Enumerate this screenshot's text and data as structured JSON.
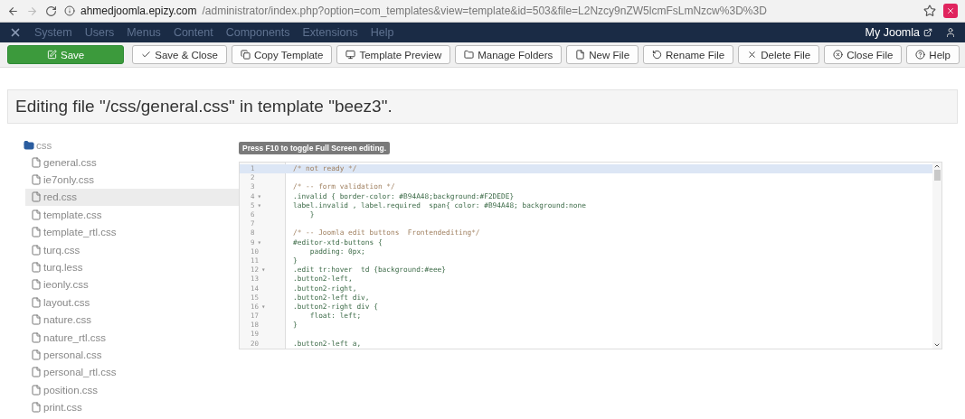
{
  "browser": {
    "url_host": "ahmedjoomla.epizy.com",
    "url_path": "/administrator/index.php?option=com_templates&view=template&id=503&file=L2Nzcy9nZW5lcmFsLmNzcw%3D%3D"
  },
  "navbar": {
    "menus": [
      "System",
      "Users",
      "Menus",
      "Content",
      "Components",
      "Extensions",
      "Help"
    ],
    "site_link": "My Joomla"
  },
  "toolbar": [
    {
      "label": "Save",
      "kind": "primary"
    },
    {
      "label": "Save & Close",
      "kind": "default"
    },
    {
      "label": "Copy Template",
      "kind": "default"
    },
    {
      "label": "Template Preview",
      "kind": "default"
    },
    {
      "label": "Manage Folders",
      "kind": "default"
    },
    {
      "label": "New File",
      "kind": "default"
    },
    {
      "label": "Rename File",
      "kind": "default"
    },
    {
      "label": "Delete File",
      "kind": "default"
    },
    {
      "label": "Close File",
      "kind": "default"
    },
    {
      "label": "Help",
      "kind": "help"
    }
  ],
  "page_title": "Editing file \"/css/general.css\" in template \"beez3\".",
  "tree": {
    "folder": "css",
    "files": [
      {
        "name": "general.css",
        "selected": false
      },
      {
        "name": "ie7only.css",
        "selected": false
      },
      {
        "name": "red.css",
        "selected": true
      },
      {
        "name": "template.css",
        "selected": false
      },
      {
        "name": "template_rtl.css",
        "selected": false
      },
      {
        "name": "turq.css",
        "selected": false
      },
      {
        "name": "turq.less",
        "selected": false
      },
      {
        "name": "ieonly.css",
        "selected": false
      },
      {
        "name": "layout.css",
        "selected": false
      },
      {
        "name": "nature.css",
        "selected": false
      },
      {
        "name": "nature_rtl.css",
        "selected": false
      },
      {
        "name": "personal.css",
        "selected": false
      },
      {
        "name": "personal_rtl.css",
        "selected": false
      },
      {
        "name": "position.css",
        "selected": false
      },
      {
        "name": "print.css",
        "selected": false
      }
    ]
  },
  "editor": {
    "hint": "Press F10 to toggle Full Screen editing.",
    "lines": [
      {
        "number": "1",
        "kind": "comment",
        "active": true,
        "text": "/* not ready */"
      },
      {
        "number": "2",
        "active": false
      },
      {
        "number": "3",
        "kind": "comment",
        "active": false,
        "text": "/* -- form validation */"
      },
      {
        "number": "4",
        "kind": "code",
        "active": false,
        "fold_mark": "▾",
        "text": ".invalid { border-color: #B94A48;background:#F2DEDE}"
      },
      {
        "number": "5",
        "kind": "code",
        "active": false,
        "fold_mark": "▾",
        "text": "label.invalid , label.required  span{ color: #B94A48; background:none"
      },
      {
        "number": "6",
        "kind": "code",
        "active": false,
        "text": "    }"
      },
      {
        "number": "7",
        "active": false
      },
      {
        "number": "8",
        "kind": "comment",
        "active": false,
        "text": "/* -- Joomla edit buttons  Frontendediting*/"
      },
      {
        "number": "9",
        "kind": "code",
        "active": false,
        "fold_mark": "▾",
        "text": "#editor-xtd-buttons {"
      },
      {
        "number": "10",
        "kind": "code",
        "active": false,
        "text": "    padding: 0px;"
      },
      {
        "number": "11",
        "kind": "code",
        "active": false,
        "text": "}"
      },
      {
        "number": "12",
        "kind": "code",
        "active": false,
        "fold_mark": "▾",
        "text": ".edit tr:hover  td {background:#eee}"
      },
      {
        "number": "13",
        "kind": "code",
        "active": false,
        "text": ".button2-left,"
      },
      {
        "number": "14",
        "kind": "code",
        "active": false,
        "text": ".button2-right,"
      },
      {
        "number": "15",
        "kind": "code",
        "active": false,
        "text": ".button2-left div,"
      },
      {
        "number": "16",
        "kind": "code",
        "active": false,
        "fold_mark": "▾",
        "text": ".button2-right div {"
      },
      {
        "number": "17",
        "kind": "code",
        "active": false,
        "text": "    float: left;"
      },
      {
        "number": "18",
        "kind": "code",
        "active": false,
        "text": "}"
      },
      {
        "number": "19",
        "active": false
      },
      {
        "number": "20",
        "kind": "code",
        "active": false,
        "text": ".button2-left a,"
      }
    ]
  }
}
